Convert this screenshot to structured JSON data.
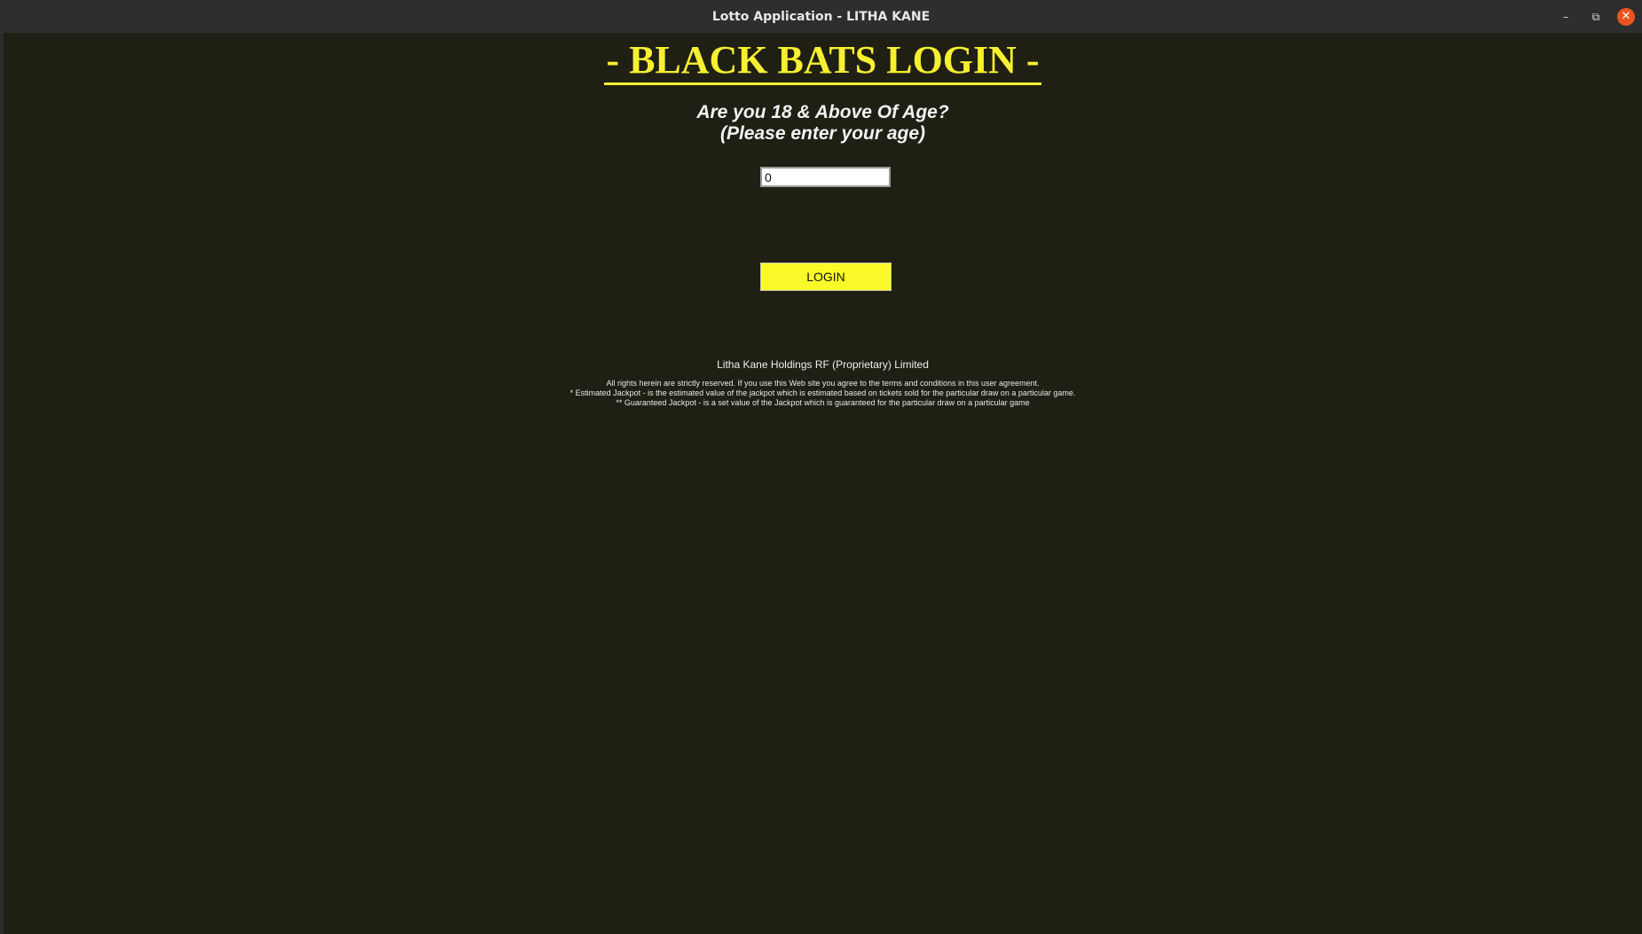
{
  "window": {
    "title": "Lotto Application - LITHA KANE",
    "controls": {
      "minimize_icon": "–",
      "maximize_icon": "⧉",
      "close_icon": "✕"
    }
  },
  "login": {
    "heading": "- BLACK BATS LOGIN -",
    "question_line1": "Are you 18 & Above Of Age?",
    "question_line2": "(Please enter your age)",
    "age_value": "0",
    "button_label": "LOGIN"
  },
  "footer": {
    "company": "Litha Kane Holdings RF (Proprietary) Limited",
    "rights": "All rights herein are strictly reserved. If you use this Web site you agree to the terms and conditions in this user agreement.",
    "estimated_note": "* Estimated Jackpot - is the estimated value of the jackpot which is estimated based on tickets sold for the particular draw on a particular game.",
    "guaranteed_note": "** Guaranteed Jackpot - is a set value of the Jackpot which is guaranteed for the particular draw on a particular game"
  },
  "colors": {
    "background": "#201f14",
    "accent_yellow": "#f6f030",
    "button_yellow": "#fafa2a",
    "close_button": "#e9541f"
  }
}
